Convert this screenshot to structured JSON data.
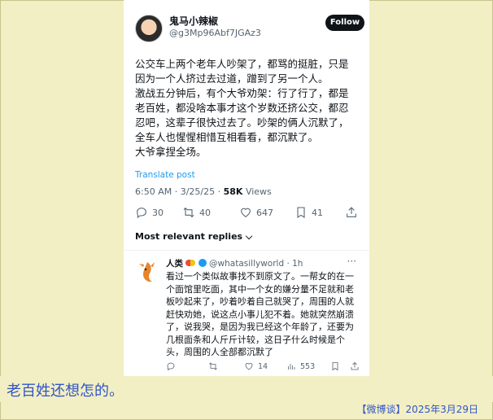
{
  "tweet": {
    "author_name": "鬼马小辣椒",
    "author_handle": "@g3Mp96Abf7JGAz3",
    "follow_label": "Follow",
    "lines": [
      "公交车上两个老年人吵架了，都骂的挺脏，只是",
      "因为一个人挤过去过道，蹭到了另一个人。",
      "激战五分钟后，有个大爷劝架：行了行了，都是",
      "老百姓，都没啥本事才这个岁数还挤公交，都忍",
      "忍吧，这辈子很快过去了。吵架的俩人沉默了，",
      "全车人也惺惺相惜互相看看，都沉默了。",
      "大爷拿捏全场。"
    ],
    "translate_label": "Translate post",
    "time": "6:50 AM · 3/25/25 · ",
    "views_count": "58K",
    "views_label": " Views",
    "replies": "30",
    "reposts": "40",
    "likes": "647",
    "bookmarks": "41"
  },
  "most_relevant_label": "Most relevant replies ⌵",
  "reply": {
    "name": "人类",
    "handle": "@whatasillyworld · 1h",
    "more": "···",
    "lines": [
      "看过一个类似故事找不到原文了。一帮女的在一",
      "个面馆里吃面，其中一个女的嫌分量不足就和老",
      "板吵起来了，吵着吵着自己就哭了，周围的人就",
      "赶快劝她，说这点小事儿犯不着。她就突然崩溃",
      "了，说我哭，是因为我已经这个年龄了，还要为",
      "几根面条和人斤斤计较，这日子什么时候是个",
      "头，周围的人全部都沉默了"
    ],
    "likes": "14",
    "views": "553"
  },
  "caption": "老百姓还想怎的。",
  "footer": "【微博谈】2025年3月29日",
  "icons": {
    "reply": "reply-icon",
    "repost": "repost-icon",
    "like": "heart-icon",
    "bookmark": "bookmark-icon",
    "share": "share-icon",
    "views": "views-icon"
  },
  "colors": {
    "background": "#f3efc4",
    "accent": "#1d9bf0",
    "caption": "#2f55c8"
  }
}
